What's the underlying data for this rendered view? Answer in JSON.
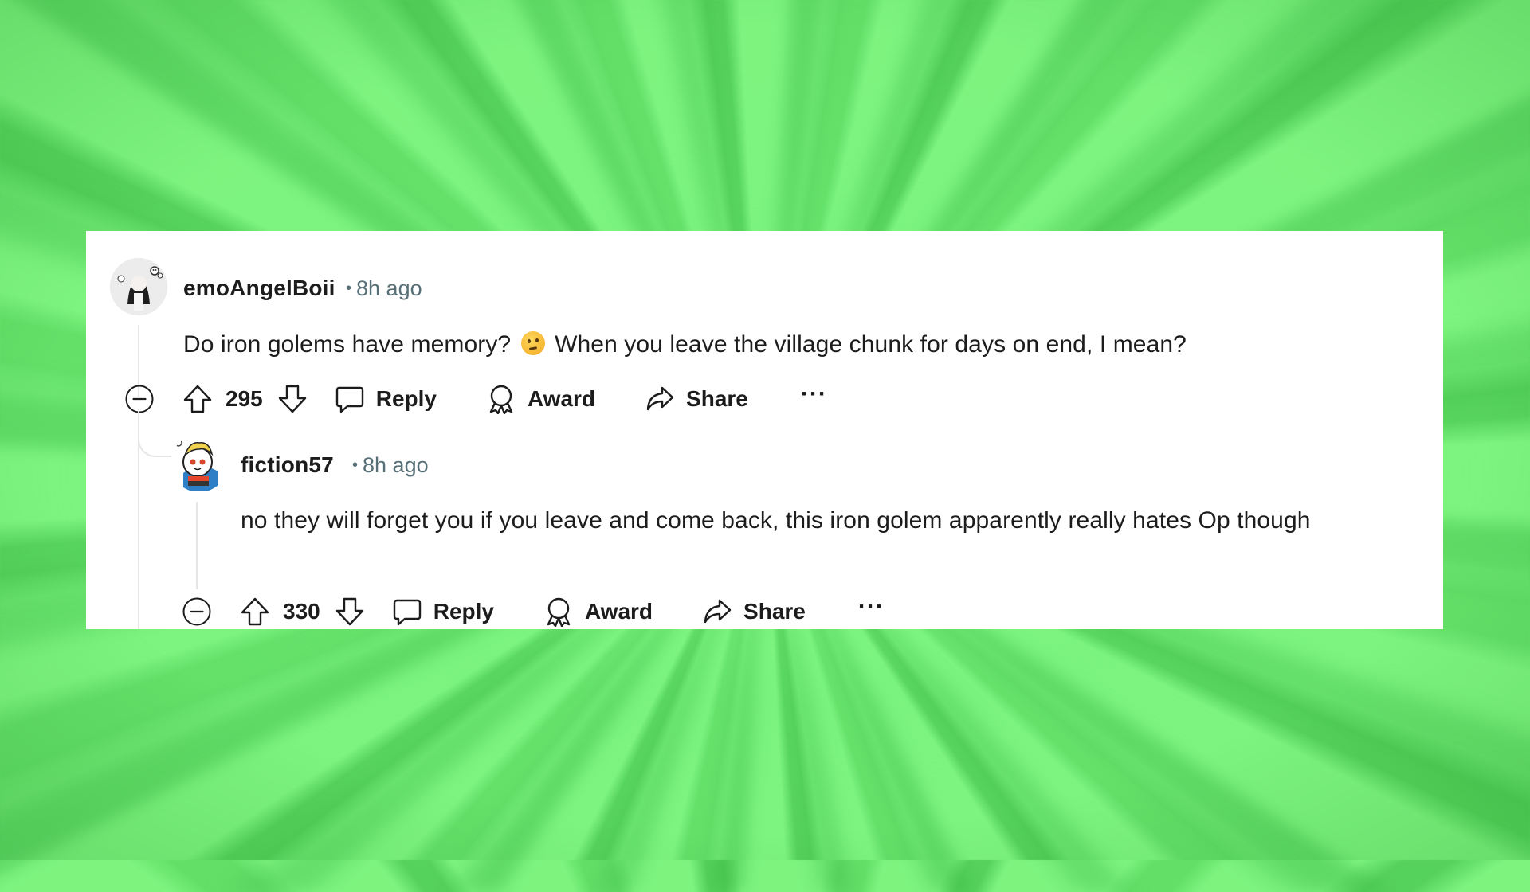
{
  "comments": [
    {
      "username": "emoAngelBoii",
      "timestamp": "8h ago",
      "text_before_emoji": "Do iron golems have memory?",
      "emoji": "thinking-face",
      "text_after_emoji": "When you leave the village chunk for days on end, I mean?",
      "score": "295",
      "actions": {
        "reply": "Reply",
        "award": "Award",
        "share": "Share",
        "more": "···"
      }
    },
    {
      "username": "fiction57",
      "timestamp": "8h ago",
      "text": "no they will forget you if you leave and come back, this iron golem apparently really hates Op though",
      "score": "330",
      "actions": {
        "reply": "Reply",
        "award": "Award",
        "share": "Share",
        "more": "···"
      }
    }
  ],
  "icons": {
    "collapse": "minus-circle-icon",
    "upvote": "arrow-up-icon",
    "downvote": "arrow-down-icon",
    "reply": "speech-bubble-icon",
    "award": "award-ribbon-icon",
    "share": "share-arrow-icon"
  },
  "colors": {
    "background_green": "#7ef47f",
    "card": "#ffffff",
    "text": "#1c1c1c",
    "meta": "#576f76",
    "thread_line": "#e4e6e8"
  }
}
